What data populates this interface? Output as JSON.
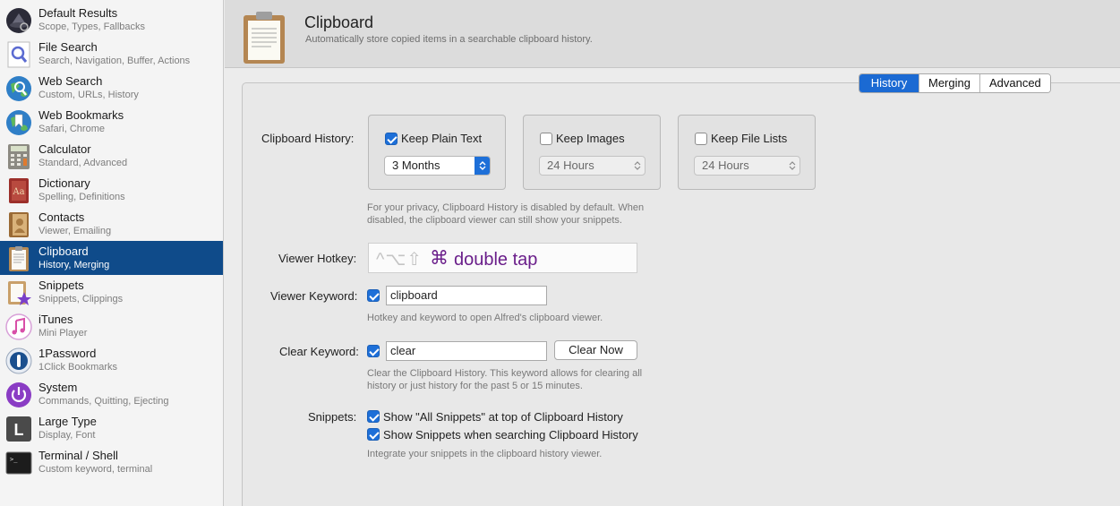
{
  "sidebar": {
    "items": [
      {
        "title": "Default Results",
        "subtitle": "Scope, Types, Fallbacks",
        "icon": "alfred-hat-icon",
        "selected": false
      },
      {
        "title": "File Search",
        "subtitle": "Search, Navigation, Buffer, Actions",
        "icon": "magnifier-icon",
        "selected": false
      },
      {
        "title": "Web Search",
        "subtitle": "Custom, URLs, History",
        "icon": "globe-search-icon",
        "selected": false
      },
      {
        "title": "Web Bookmarks",
        "subtitle": "Safari, Chrome",
        "icon": "globe-bookmark-icon",
        "selected": false
      },
      {
        "title": "Calculator",
        "subtitle": "Standard, Advanced",
        "icon": "calculator-icon",
        "selected": false
      },
      {
        "title": "Dictionary",
        "subtitle": "Spelling, Definitions",
        "icon": "dictionary-icon",
        "selected": false
      },
      {
        "title": "Contacts",
        "subtitle": "Viewer, Emailing",
        "icon": "contacts-icon",
        "selected": false
      },
      {
        "title": "Clipboard",
        "subtitle": "History, Merging",
        "icon": "clipboard-icon",
        "selected": true
      },
      {
        "title": "Snippets",
        "subtitle": "Snippets, Clippings",
        "icon": "snippets-star-icon",
        "selected": false
      },
      {
        "title": "iTunes",
        "subtitle": "Mini Player",
        "icon": "itunes-note-icon",
        "selected": false
      },
      {
        "title": "1Password",
        "subtitle": "1Click Bookmarks",
        "icon": "onepassword-icon",
        "selected": false
      },
      {
        "title": "System",
        "subtitle": "Commands, Quitting, Ejecting",
        "icon": "power-icon",
        "selected": false
      },
      {
        "title": "Large Type",
        "subtitle": "Display, Font",
        "icon": "large-type-icon",
        "selected": false
      },
      {
        "title": "Terminal / Shell",
        "subtitle": "Custom keyword, terminal",
        "icon": "terminal-icon",
        "selected": false
      }
    ]
  },
  "header": {
    "title": "Clipboard",
    "subtitle": "Automatically store copied items in a searchable clipboard history."
  },
  "tabs": [
    {
      "label": "History",
      "active": true
    },
    {
      "label": "Merging",
      "active": false
    },
    {
      "label": "Advanced",
      "active": false
    }
  ],
  "history": {
    "label": "Clipboard History:",
    "plain_text": {
      "label": "Keep Plain Text",
      "checked": true,
      "duration": "3 Months"
    },
    "images": {
      "label": "Keep Images",
      "checked": false,
      "duration": "24 Hours"
    },
    "file_lists": {
      "label": "Keep File Lists",
      "checked": false,
      "duration": "24 Hours"
    },
    "note_line1": "For your privacy, Clipboard History is disabled by default. When",
    "note_line2": "disabled, the clipboard viewer can still show your snippets."
  },
  "viewer_hotkey": {
    "label": "Viewer Hotkey:",
    "modifiers": "^⌥⇧",
    "command_symbol": "⌘",
    "text": "double tap"
  },
  "viewer_keyword": {
    "label": "Viewer Keyword:",
    "checked": true,
    "value": "clipboard",
    "note": "Hotkey and keyword to open Alfred's clipboard viewer."
  },
  "clear_keyword": {
    "label": "Clear Keyword:",
    "checked": true,
    "value": "clear",
    "button": "Clear Now",
    "note_line1": "Clear the Clipboard History. This keyword allows for clearing all",
    "note_line2": "history or just history for the past 5 or 15 minutes."
  },
  "snippets": {
    "label": "Snippets:",
    "option1": "Show \"All Snippets\" at top of Clipboard History",
    "option2": "Show Snippets when searching Clipboard History",
    "note": "Integrate your snippets in the clipboard history viewer."
  }
}
